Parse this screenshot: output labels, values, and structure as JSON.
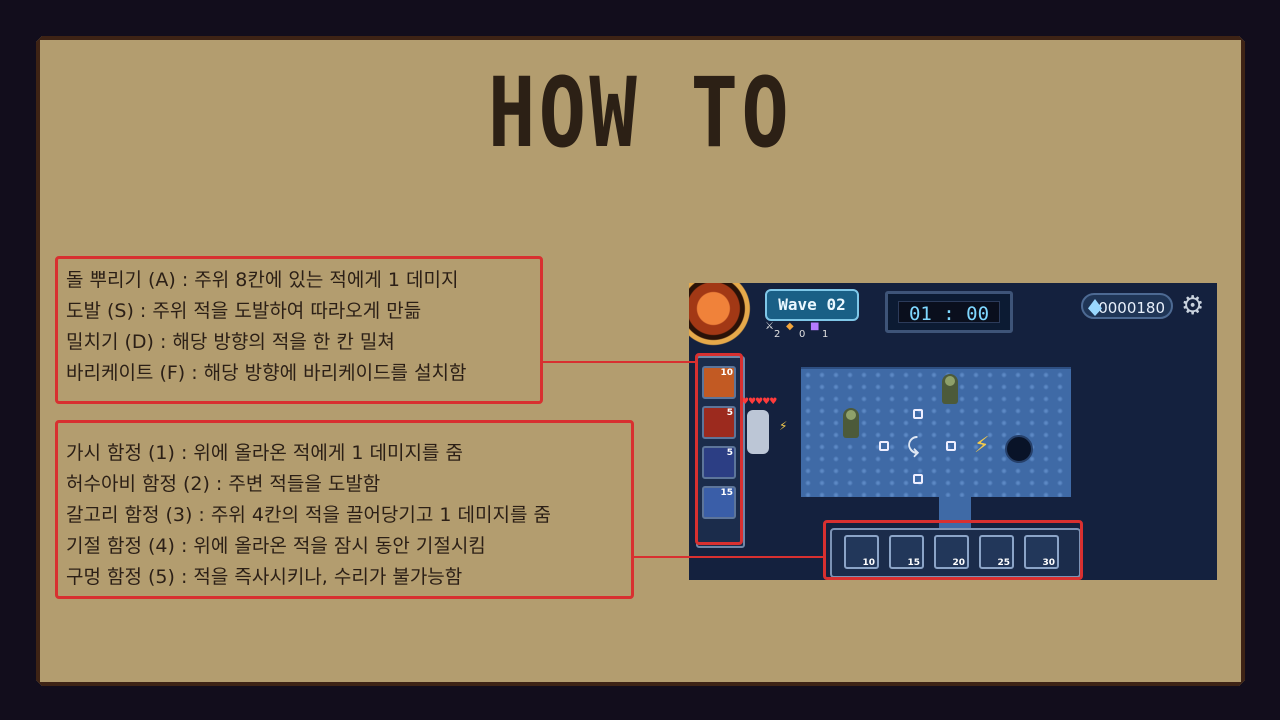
{
  "title": "HOW TO",
  "skills": [
    "돌 뿌리기 (A) : 주위 8칸에 있는 적에게 1 데미지",
    "도발 (S) : 주위 적을 도발하여 따라오게 만듦",
    "밀치기 (D) : 해당 방향의 적을 한 칸 밀쳐",
    "바리케이트 (F) : 해당 방향에 바리케이드를 설치함"
  ],
  "traps": [
    "가시 함정 (1) : 위에 올라온 적에게 1 데미지를 줌",
    "허수아비 함정 (2) : 주변 적들을 도발함",
    "갈고리 함정 (3) : 주위 4칸의 적을 끌어당기고 1 데미지를 줌",
    "기절 함정 (4) : 위에 올라온 적을 잠시 동안 기절시킴",
    "구멍 함정 (5) : 적을 즉사시키나, 수리가 불가능함"
  ],
  "game": {
    "wave": "Wave 02",
    "stat_counts": [
      "2",
      "0",
      "1"
    ],
    "timer": "01 : 00",
    "gems": "0000180",
    "skill_slots": [
      "10",
      "5",
      "5",
      "15"
    ],
    "trap_slots": [
      "10",
      "15",
      "20",
      "25",
      "30"
    ],
    "icons": [
      "gem-icon",
      "gear-icon",
      "sword-icon",
      "shield-icon",
      "potion-icon"
    ],
    "colors": {
      "highlight": "#d83030",
      "panel": "#b39d6f",
      "title": "#2c2015"
    }
  }
}
